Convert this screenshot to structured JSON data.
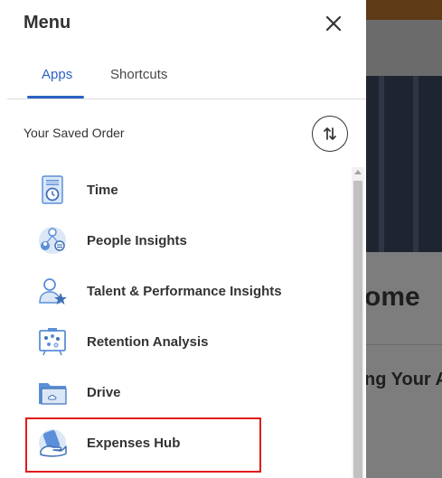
{
  "menu": {
    "title": "Menu",
    "close_icon": "close-icon"
  },
  "tabs": [
    {
      "label": "Apps",
      "active": true
    },
    {
      "label": "Shortcuts",
      "active": false
    }
  ],
  "saved_order": {
    "label": "Your Saved Order",
    "sort_icon": "sort-arrows-icon"
  },
  "apps": [
    {
      "label": "Time",
      "icon": "clock-sheet-icon"
    },
    {
      "label": "People Insights",
      "icon": "people-insights-icon"
    },
    {
      "label": "Talent & Performance Insights",
      "icon": "talent-star-icon"
    },
    {
      "label": "Retention Analysis",
      "icon": "retention-board-icon"
    },
    {
      "label": "Drive",
      "icon": "drive-folder-icon"
    },
    {
      "label": "Expenses Hub",
      "icon": "expenses-icon"
    }
  ],
  "background_page": {
    "heading_fragment": "ome",
    "subheading_fragment": "ng Your A"
  },
  "colors": {
    "accent": "#2a62c4",
    "highlight_border": "#e31b1b",
    "icon_blue": "#5b8fd9",
    "icon_light": "#dbe7f7"
  }
}
